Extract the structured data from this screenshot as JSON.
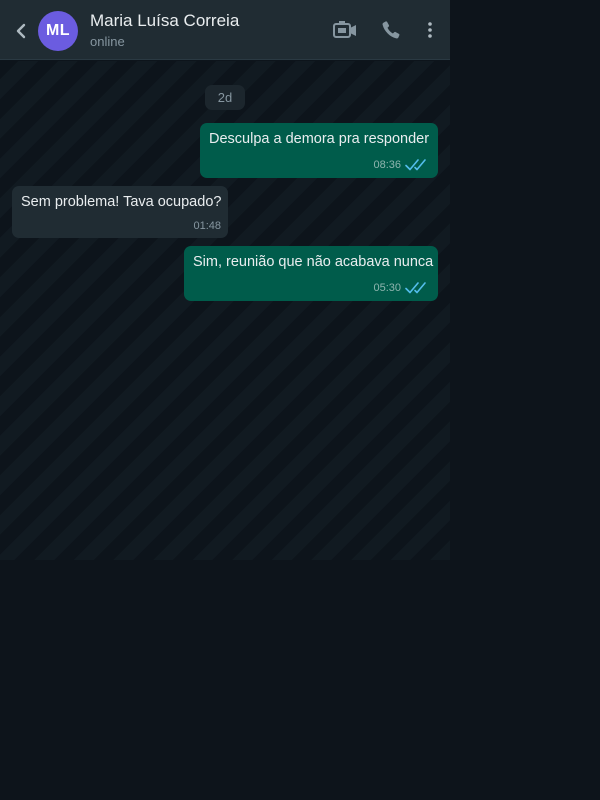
{
  "header": {
    "contact_name": "Maria Luísa Correia",
    "avatar_initials": "ML",
    "status": "online",
    "avatar_color": "#6b5ce0",
    "icons": [
      "back-arrow",
      "video-call",
      "voice-call",
      "more-vertical"
    ]
  },
  "conversation": {
    "date_label": "2d",
    "messages": [
      {
        "direction": "outgoing",
        "text": "Desculpa a demora pra responder",
        "time": "08:36",
        "status": "read"
      },
      {
        "direction": "incoming",
        "text": "Sem problema! Tava ocupado?",
        "time": "01:48"
      },
      {
        "direction": "outgoing",
        "text": "Sim, reunião que não acabava nunca",
        "time": "05:30",
        "status": "read"
      }
    ]
  },
  "colors": {
    "header_bg": "#202c33",
    "chat_bg": "#0d141b",
    "outgoing_bubble": "#005c4b",
    "incoming_bubble": "#202c33",
    "read_ticks": "#53bdeb"
  }
}
